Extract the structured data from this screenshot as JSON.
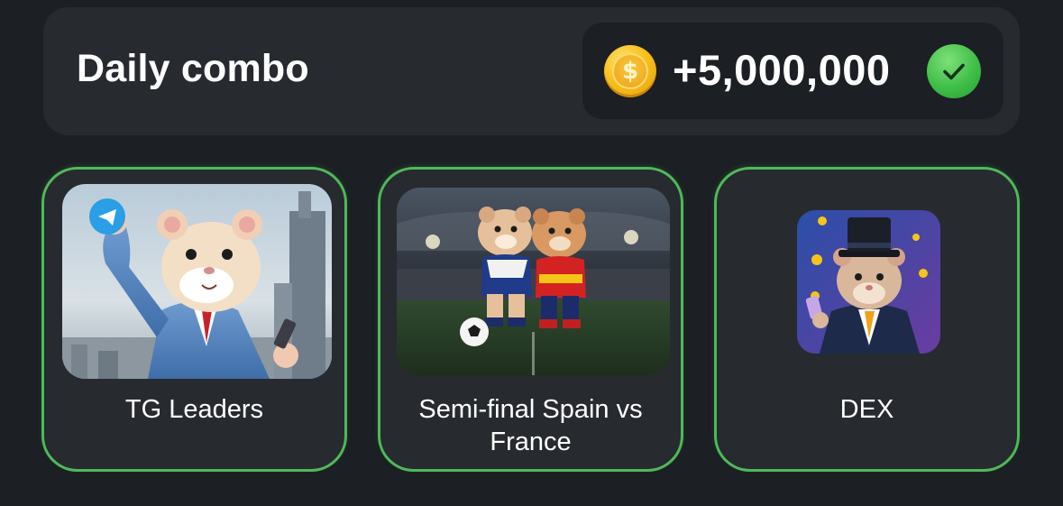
{
  "header": {
    "title": "Daily combo",
    "reward": {
      "coin_symbol": "$",
      "amount": "+5,000,000",
      "status_icon": "check-icon",
      "status_color": "#3fbf47"
    }
  },
  "cards": [
    {
      "label": "TG Leaders",
      "image": "hamster-businessman-telegram-illustration",
      "selected": true
    },
    {
      "label": "Semi-final Spain vs France",
      "image": "hamsters-playing-football-illustration",
      "selected": true
    },
    {
      "label": "DEX",
      "image": "hamster-top-hat-coins-illustration",
      "selected": true
    }
  ],
  "colors": {
    "background": "#1c1f24",
    "panel": "#272a2f",
    "accent_green": "#4fb959",
    "coin_gold": "#f8c21a"
  }
}
